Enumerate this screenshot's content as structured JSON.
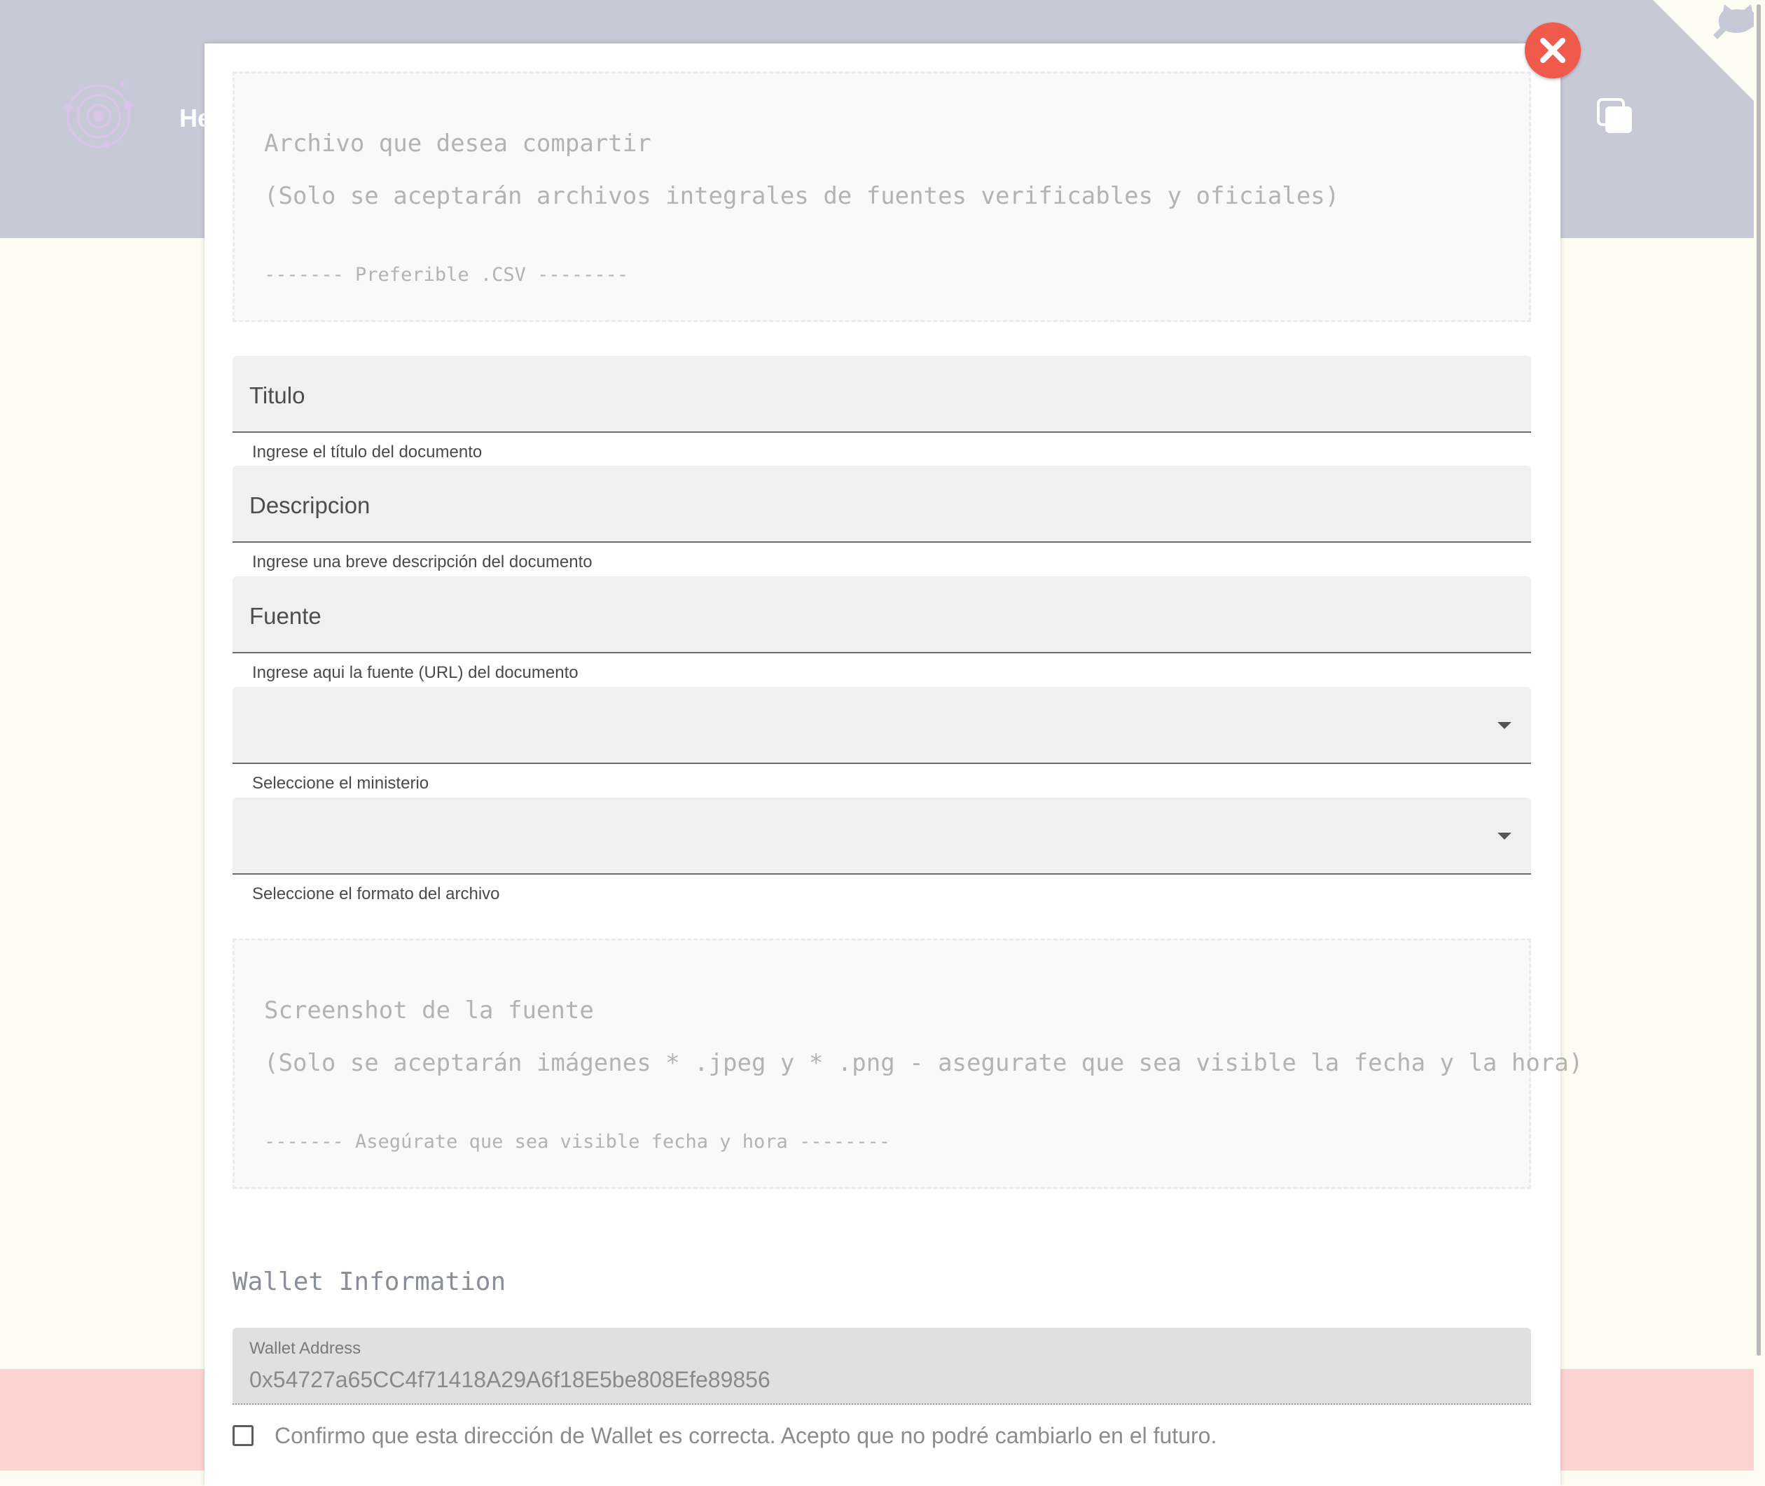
{
  "background": {
    "brand_text": "He",
    "header_color": "#c7cad6",
    "footer_color": "#fdd3d2",
    "page_color": "#fdfcf3"
  },
  "modal": {
    "close_icon": "close-icon",
    "close_color": "#f05a4b",
    "file_upload": {
      "title": "Archivo que desea compartir",
      "subtitle": "(Solo se aceptarán archivos integrales de fuentes verificables y oficiales)",
      "hint": "------- Preferible .CSV --------"
    },
    "fields": {
      "titulo": {
        "label": "Titulo",
        "value": "",
        "helper": "Ingrese el título del documento"
      },
      "descripcion": {
        "label": "Descripcion",
        "value": "",
        "helper": "Ingrese una breve descripción del documento"
      },
      "fuente": {
        "label": "Fuente",
        "value": "",
        "helper": "Ingrese aqui la fuente (URL) del documento"
      },
      "ministerio": {
        "value": "",
        "helper": "Seleccione el ministerio"
      },
      "formato": {
        "value": "",
        "helper": "Seleccione el formato del archivo"
      }
    },
    "screenshot_upload": {
      "title": "Screenshot de la fuente",
      "subtitle": "(Solo se aceptarán imágenes * .jpeg y * .png - asegurate que sea visible la fecha y la hora)",
      "hint": "------- Asegúrate que sea visible fecha y hora --------"
    },
    "wallet": {
      "section_title": "Wallet Information",
      "label": "Wallet Address",
      "address": "0x54727a65CC4f71418A29A6f18E5be808Efe89856",
      "confirm_text": "Confirmo que esta dirección de Wallet es correcta. Acepto que no podré cambiarlo en el futuro.",
      "confirmed": false
    }
  }
}
